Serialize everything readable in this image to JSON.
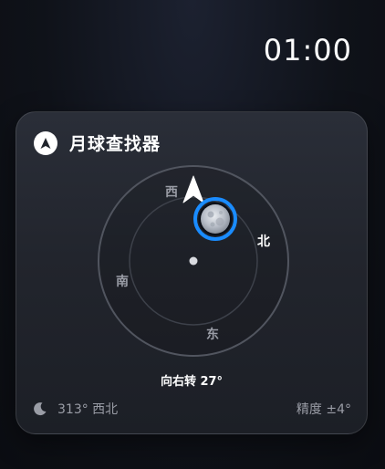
{
  "status_bar": {
    "time": "01:00"
  },
  "card": {
    "title": "月球查找器",
    "header_icon": "navigation-arrow-icon",
    "compass": {
      "north": "北",
      "south": "南",
      "east": "东",
      "west": "西",
      "moon_icon": "moon-icon",
      "pointer_icon": "direction-pointer-icon",
      "accent_color": "#1a8cff"
    },
    "turn_hint": "向右转 27°",
    "footer": {
      "bearing_icon": "crescent-moon-icon",
      "bearing": "313° 西北",
      "accuracy": "精度 ±4°"
    }
  }
}
